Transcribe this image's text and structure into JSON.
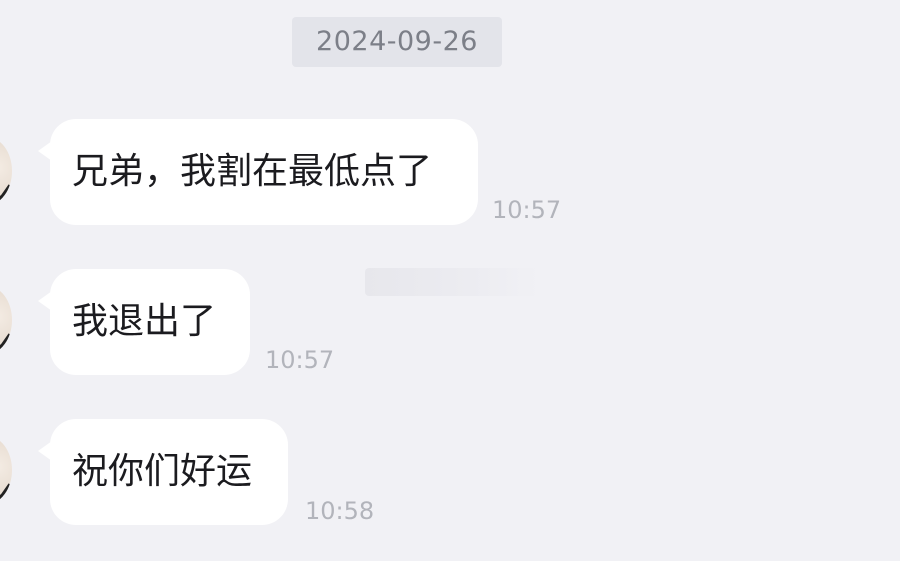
{
  "date_separator": "2024-09-26",
  "messages": [
    {
      "text": "兄弟，我割在最低点了",
      "time": "10:57"
    },
    {
      "text": "我退出了",
      "time": "10:57"
    },
    {
      "text": "祝你们好运",
      "time": "10:58"
    }
  ],
  "colors": {
    "background": "#f1f1f5",
    "bubble": "#ffffff",
    "date_chip": "#e3e4ea",
    "timestamp": "#b2b4bb"
  }
}
